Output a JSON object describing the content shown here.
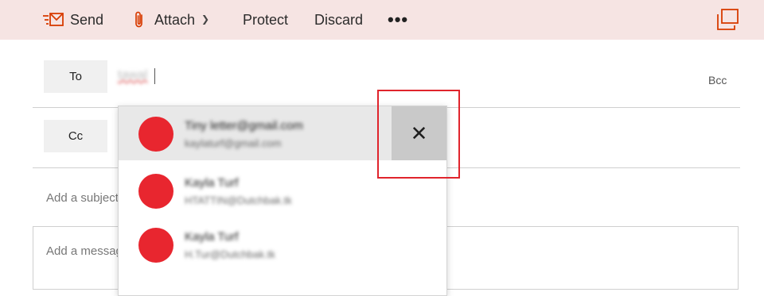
{
  "toolbar": {
    "send_label": "Send",
    "attach_label": "Attach",
    "protect_label": "Protect",
    "discard_label": "Discard",
    "more_label": "•••",
    "icons": {
      "send": "send-icon",
      "attach": "paperclip-icon",
      "attach_chevron": "chevron-down-icon",
      "popout": "popout-icon"
    },
    "accent_color": "#d83b01",
    "background_color": "#f6e4e3"
  },
  "compose": {
    "to_label": "To",
    "cc_label": "Cc",
    "bcc_label": "Bcc",
    "to_value": "tawal",
    "subject_placeholder": "Add a subject",
    "message_placeholder": "Add a message"
  },
  "suggestions": [
    {
      "name": "Tiny letter@gmail.com",
      "email": "kaylaturf@gmail.com",
      "avatar_color": "#e8262f",
      "selected": true
    },
    {
      "name": "Kayla Turf",
      "email": "HTATTIN@Dutchbak.tk",
      "avatar_color": "#e8262f",
      "selected": false
    },
    {
      "name": "Kayla Turf",
      "email": "H.Tur@Dutchbak.tk",
      "avatar_color": "#e8262f",
      "selected": false
    }
  ],
  "remove_suggestion": {
    "label": "✕",
    "icon": "close-icon"
  },
  "highlight_color": "#e0242c"
}
